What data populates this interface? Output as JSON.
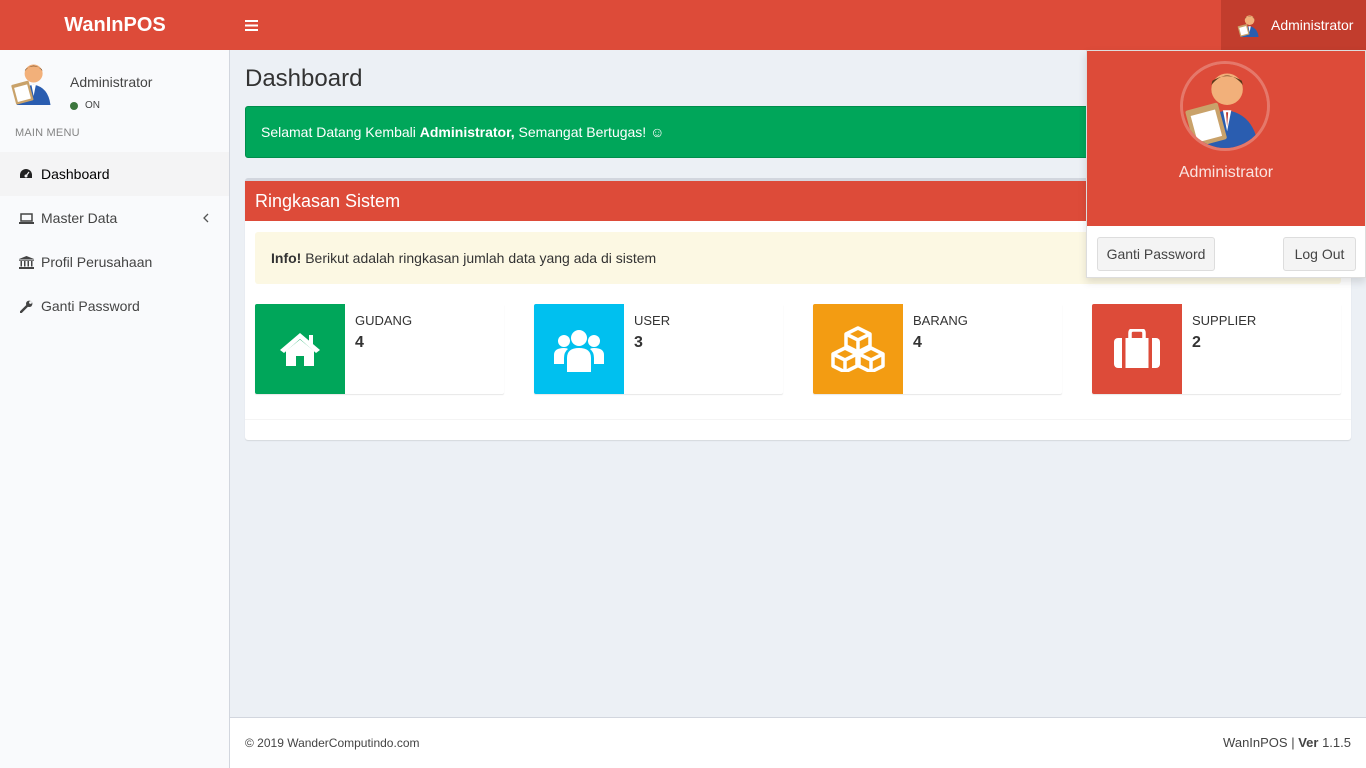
{
  "app": {
    "brand": "WanInPOS"
  },
  "header": {
    "user_name": "Administrator"
  },
  "sidebar": {
    "user_name": "Administrator",
    "status": "ON",
    "menu_header": "MAIN MENU",
    "items": [
      {
        "label": "Dashboard",
        "icon": "dashboard-icon",
        "active": true
      },
      {
        "label": "Master Data",
        "icon": "laptop-icon",
        "active": false
      },
      {
        "label": "Profil Perusahaan",
        "icon": "bank-icon",
        "active": false
      },
      {
        "label": "Ganti Password",
        "icon": "wrench-icon",
        "active": false
      }
    ]
  },
  "main": {
    "title": "Dashboard",
    "welcome": {
      "prefix": "Selamat Datang Kembali ",
      "name": "Administrator,",
      "suffix": " Semangat Bertugas! ☺"
    },
    "summary_box": {
      "title": "Ringkasan Sistem",
      "info_label": "Info!",
      "info_text": " Berikut adalah ringkasan jumlah data yang ada di sistem",
      "stats": [
        {
          "label": "GUDANG",
          "value": "4",
          "color": "#00a65a",
          "icon": "home-icon"
        },
        {
          "label": "USER",
          "value": "3",
          "color": "#00c0ef",
          "icon": "users-icon"
        },
        {
          "label": "BARANG",
          "value": "4",
          "color": "#f39c12",
          "icon": "cubes-icon"
        },
        {
          "label": "SUPPLIER",
          "value": "2",
          "color": "#dd4b39",
          "icon": "briefcase-icon"
        }
      ]
    }
  },
  "dropdown": {
    "user_name": "Administrator",
    "change_password": "Ganti Password",
    "logout": "Log Out"
  },
  "footer": {
    "copyright": "© 2019  WanderComputindo.com",
    "app_name": "WanInPOS",
    "ver_label": "Ver",
    "version": "1.1.5"
  },
  "colors": {
    "primary": "#dd4b39",
    "success": "#00a65a",
    "aqua": "#00c0ef",
    "yellow": "#f39c12"
  }
}
